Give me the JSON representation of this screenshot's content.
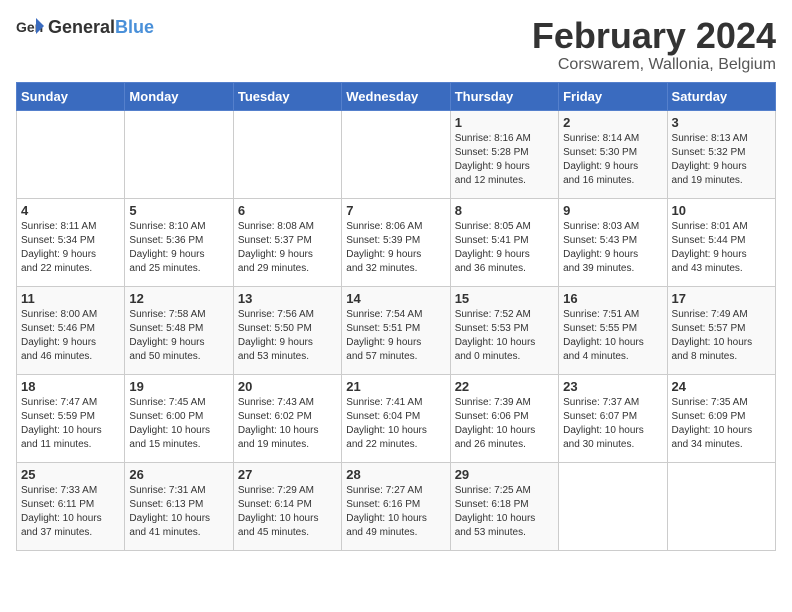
{
  "logo": {
    "text_general": "General",
    "text_blue": "Blue"
  },
  "title": "February 2024",
  "subtitle": "Corswarem, Wallonia, Belgium",
  "headers": [
    "Sunday",
    "Monday",
    "Tuesday",
    "Wednesday",
    "Thursday",
    "Friday",
    "Saturday"
  ],
  "weeks": [
    [
      {
        "day": "",
        "info": ""
      },
      {
        "day": "",
        "info": ""
      },
      {
        "day": "",
        "info": ""
      },
      {
        "day": "",
        "info": ""
      },
      {
        "day": "1",
        "info": "Sunrise: 8:16 AM\nSunset: 5:28 PM\nDaylight: 9 hours\nand 12 minutes."
      },
      {
        "day": "2",
        "info": "Sunrise: 8:14 AM\nSunset: 5:30 PM\nDaylight: 9 hours\nand 16 minutes."
      },
      {
        "day": "3",
        "info": "Sunrise: 8:13 AM\nSunset: 5:32 PM\nDaylight: 9 hours\nand 19 minutes."
      }
    ],
    [
      {
        "day": "4",
        "info": "Sunrise: 8:11 AM\nSunset: 5:34 PM\nDaylight: 9 hours\nand 22 minutes."
      },
      {
        "day": "5",
        "info": "Sunrise: 8:10 AM\nSunset: 5:36 PM\nDaylight: 9 hours\nand 25 minutes."
      },
      {
        "day": "6",
        "info": "Sunrise: 8:08 AM\nSunset: 5:37 PM\nDaylight: 9 hours\nand 29 minutes."
      },
      {
        "day": "7",
        "info": "Sunrise: 8:06 AM\nSunset: 5:39 PM\nDaylight: 9 hours\nand 32 minutes."
      },
      {
        "day": "8",
        "info": "Sunrise: 8:05 AM\nSunset: 5:41 PM\nDaylight: 9 hours\nand 36 minutes."
      },
      {
        "day": "9",
        "info": "Sunrise: 8:03 AM\nSunset: 5:43 PM\nDaylight: 9 hours\nand 39 minutes."
      },
      {
        "day": "10",
        "info": "Sunrise: 8:01 AM\nSunset: 5:44 PM\nDaylight: 9 hours\nand 43 minutes."
      }
    ],
    [
      {
        "day": "11",
        "info": "Sunrise: 8:00 AM\nSunset: 5:46 PM\nDaylight: 9 hours\nand 46 minutes."
      },
      {
        "day": "12",
        "info": "Sunrise: 7:58 AM\nSunset: 5:48 PM\nDaylight: 9 hours\nand 50 minutes."
      },
      {
        "day": "13",
        "info": "Sunrise: 7:56 AM\nSunset: 5:50 PM\nDaylight: 9 hours\nand 53 minutes."
      },
      {
        "day": "14",
        "info": "Sunrise: 7:54 AM\nSunset: 5:51 PM\nDaylight: 9 hours\nand 57 minutes."
      },
      {
        "day": "15",
        "info": "Sunrise: 7:52 AM\nSunset: 5:53 PM\nDaylight: 10 hours\nand 0 minutes."
      },
      {
        "day": "16",
        "info": "Sunrise: 7:51 AM\nSunset: 5:55 PM\nDaylight: 10 hours\nand 4 minutes."
      },
      {
        "day": "17",
        "info": "Sunrise: 7:49 AM\nSunset: 5:57 PM\nDaylight: 10 hours\nand 8 minutes."
      }
    ],
    [
      {
        "day": "18",
        "info": "Sunrise: 7:47 AM\nSunset: 5:59 PM\nDaylight: 10 hours\nand 11 minutes."
      },
      {
        "day": "19",
        "info": "Sunrise: 7:45 AM\nSunset: 6:00 PM\nDaylight: 10 hours\nand 15 minutes."
      },
      {
        "day": "20",
        "info": "Sunrise: 7:43 AM\nSunset: 6:02 PM\nDaylight: 10 hours\nand 19 minutes."
      },
      {
        "day": "21",
        "info": "Sunrise: 7:41 AM\nSunset: 6:04 PM\nDaylight: 10 hours\nand 22 minutes."
      },
      {
        "day": "22",
        "info": "Sunrise: 7:39 AM\nSunset: 6:06 PM\nDaylight: 10 hours\nand 26 minutes."
      },
      {
        "day": "23",
        "info": "Sunrise: 7:37 AM\nSunset: 6:07 PM\nDaylight: 10 hours\nand 30 minutes."
      },
      {
        "day": "24",
        "info": "Sunrise: 7:35 AM\nSunset: 6:09 PM\nDaylight: 10 hours\nand 34 minutes."
      }
    ],
    [
      {
        "day": "25",
        "info": "Sunrise: 7:33 AM\nSunset: 6:11 PM\nDaylight: 10 hours\nand 37 minutes."
      },
      {
        "day": "26",
        "info": "Sunrise: 7:31 AM\nSunset: 6:13 PM\nDaylight: 10 hours\nand 41 minutes."
      },
      {
        "day": "27",
        "info": "Sunrise: 7:29 AM\nSunset: 6:14 PM\nDaylight: 10 hours\nand 45 minutes."
      },
      {
        "day": "28",
        "info": "Sunrise: 7:27 AM\nSunset: 6:16 PM\nDaylight: 10 hours\nand 49 minutes."
      },
      {
        "day": "29",
        "info": "Sunrise: 7:25 AM\nSunset: 6:18 PM\nDaylight: 10 hours\nand 53 minutes."
      },
      {
        "day": "",
        "info": ""
      },
      {
        "day": "",
        "info": ""
      }
    ]
  ]
}
